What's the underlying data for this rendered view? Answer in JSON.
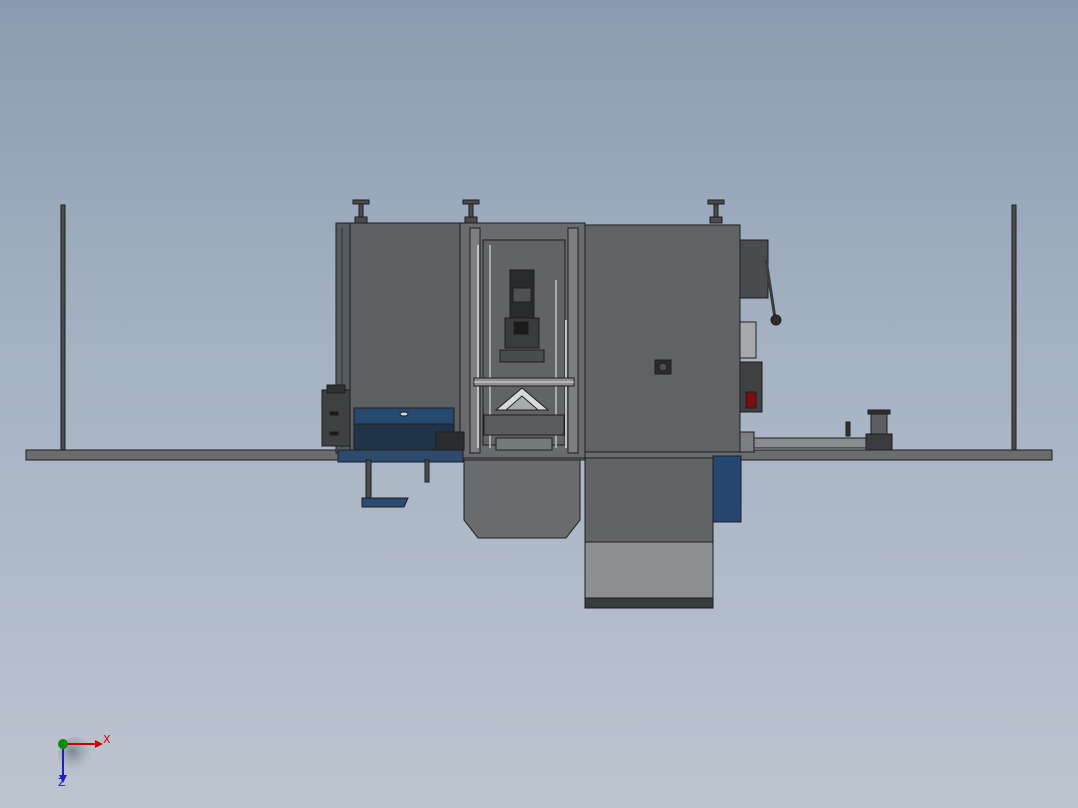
{
  "viewport": {
    "background_top": "#8a9cb1",
    "background_bottom": "#bcc4cf"
  },
  "model": {
    "steel_color": "#5f5f60",
    "steel_dark": "#3b3c3e",
    "panel_light": "#8f8f91",
    "accent_blue": "#1f3f66",
    "handle_red": "#7a0f12"
  },
  "triad": {
    "x_label": "X",
    "y_label": "",
    "z_label": "Z",
    "x_color": "#d00000",
    "y_color": "#0b8a0b",
    "z_color": "#2020c0"
  }
}
